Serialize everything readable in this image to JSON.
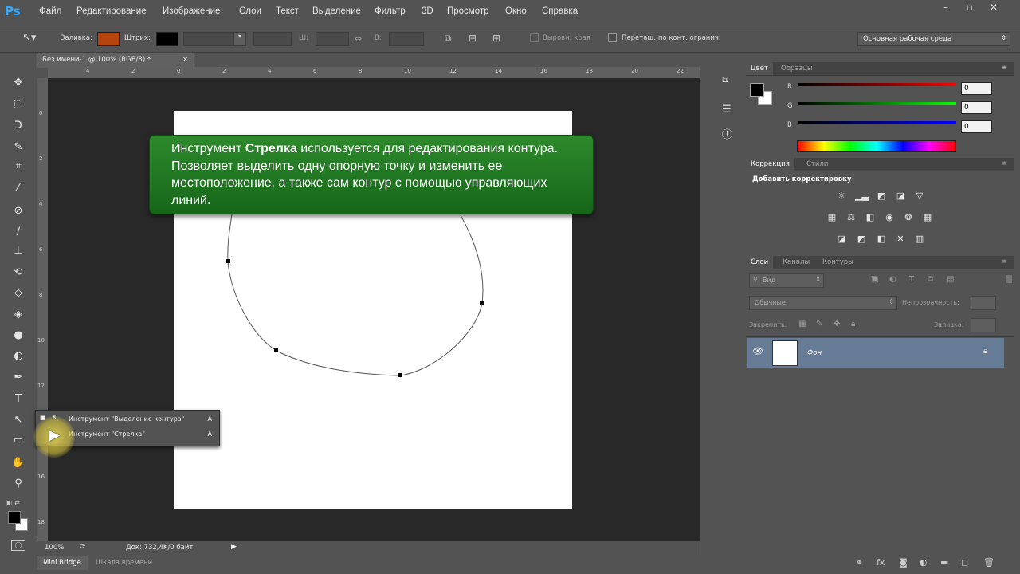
{
  "app": {
    "logo": "Ps"
  },
  "menu": [
    "Файл",
    "Редактирование",
    "Изображение",
    "Слои",
    "Текст",
    "Выделение",
    "Фильтр",
    "3D",
    "Просмотр",
    "Окно",
    "Справка"
  ],
  "window_controls": {
    "minimize": "–",
    "restore": "▫",
    "close": "✕"
  },
  "options_bar": {
    "fill_label": "Заливка:",
    "stroke_label": "Штрих:",
    "fill_color": "#b5440f",
    "stroke_color": "#000000",
    "width_label": "Ш:",
    "height_label": "В:",
    "align_edges_label": "Выровн. края",
    "constrain_label": "Перетащ. по конт. огранич.",
    "workspace": "Основная рабочая среда"
  },
  "document": {
    "tab_title": "Без имени-1 @ 100% (RGB/8) *",
    "ruler_top": [
      "4",
      "2",
      "0",
      "2",
      "4",
      "6",
      "8",
      "10",
      "12",
      "14",
      "16",
      "18",
      "20",
      "22"
    ],
    "ruler_left": [
      "0",
      "2",
      "4",
      "6",
      "8",
      "10",
      "12",
      "14",
      "16",
      "18",
      "20",
      "22"
    ]
  },
  "callout": {
    "text_before": "Инструмент ",
    "text_bold": "Стрелка",
    "text_after": " используется для редактирования контура. Позволяет выделить одну опорную точку и изменить ее местоположение, а также сам контур с помощью управляющих линий."
  },
  "tool_flyout": [
    {
      "label": "Инструмент \"Выделение контура\"",
      "key": "A"
    },
    {
      "label": "Инструмент \"Стрелка\"",
      "key": "A"
    }
  ],
  "status": {
    "zoom": "100%",
    "doc_info": "Док: 732,4K/0 байт"
  },
  "bottom_tabs": [
    "Mini Bridge",
    "Шкала времени"
  ],
  "color_panel": {
    "tabs": [
      "Цвет",
      "Образцы"
    ],
    "r_label": "R",
    "g_label": "G",
    "b_label": "B",
    "r_value": "0",
    "g_value": "0",
    "b_value": "0",
    "foreground": "#000000",
    "background": "#ffffff"
  },
  "adjustments_panel": {
    "tabs": [
      "Коррекция",
      "Стили"
    ],
    "add_label": "Добавить корректировку"
  },
  "layers_panel": {
    "tabs": [
      "Слои",
      "Каналы",
      "Контуры"
    ],
    "filter_kind": "Вид",
    "blend_mode": "Обычные",
    "opacity_label": "Непрозрачность:",
    "lock_label": "Закрепить:",
    "fill_label": "Заливка:",
    "layer_name": "Фон"
  },
  "icons": {
    "move": "move-icon",
    "marquee": "marquee-icon",
    "lasso": "lasso-icon",
    "quick-select": "quick-select-icon",
    "crop": "crop-icon",
    "eyedropper": "eyedropper-icon",
    "healing": "healing-brush-icon",
    "brush": "brush-icon",
    "stamp": "clone-stamp-icon",
    "history-brush": "history-brush-icon",
    "eraser": "eraser-icon",
    "bucket": "paint-bucket-icon",
    "blur": "blur-icon",
    "dodge": "dodge-icon",
    "pen": "pen-icon",
    "type": "type-icon",
    "path-select": "path-selection-icon",
    "rectangle": "rectangle-shape-icon",
    "hand": "hand-icon",
    "zoom": "zoom-icon"
  }
}
